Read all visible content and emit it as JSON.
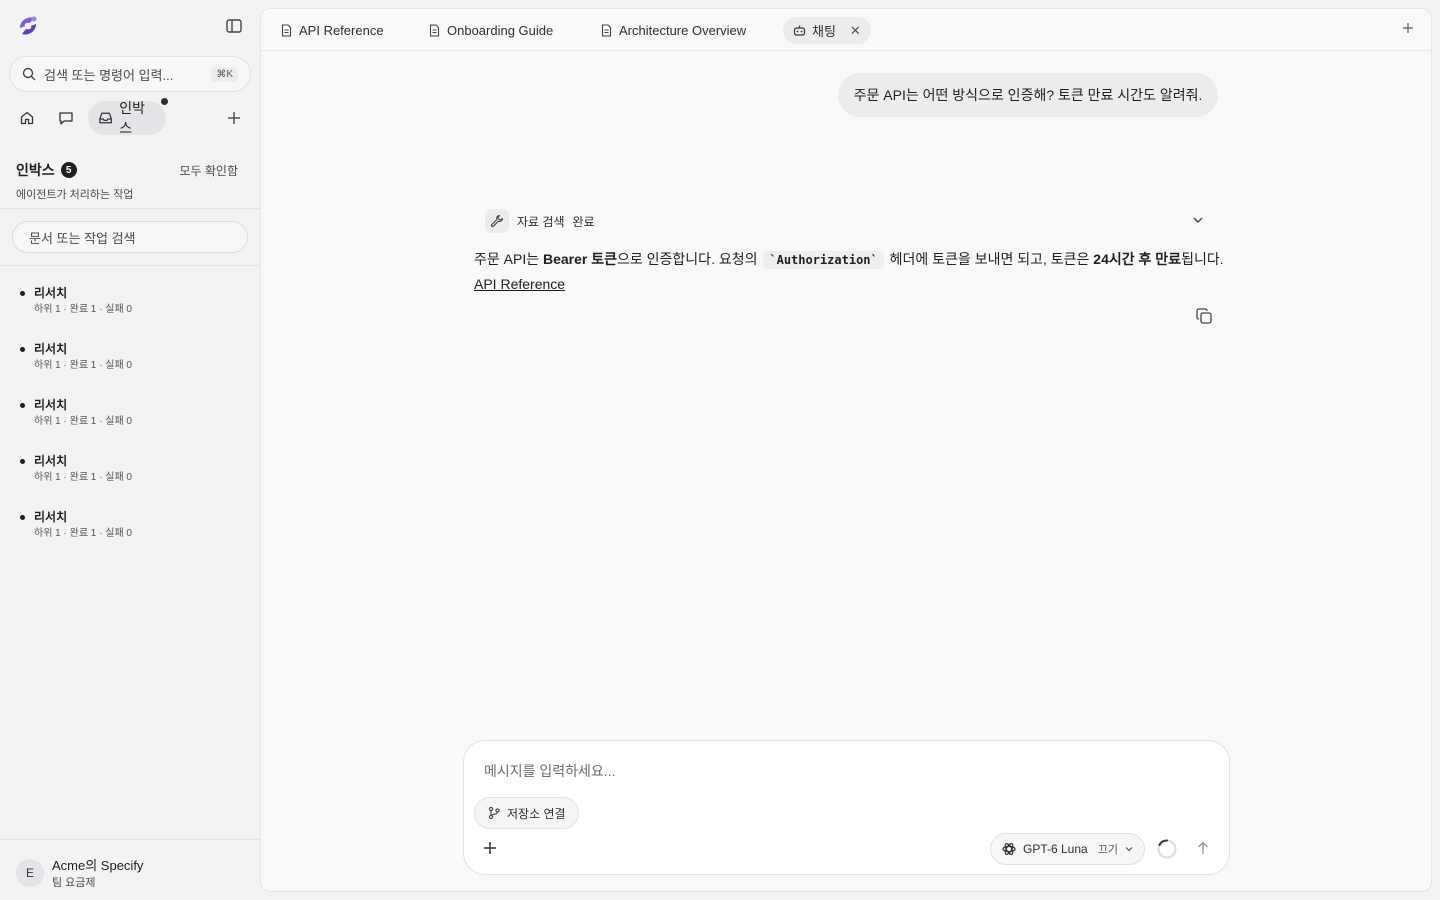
{
  "sidebar": {
    "search_placeholder": "검색 또는 명령어 입력...",
    "search_shortcut": "⌘K",
    "nav_inbox_label": "인박스",
    "inbox": {
      "title": "인박스",
      "count": "5",
      "mark_all": "모두 확인함",
      "subtitle": "에이전트가 처리하는 작업"
    },
    "doc_search_placeholder": "문서 또는 작업 검색",
    "tasks": [
      {
        "title": "리서치",
        "meta": "하위 1 · 완료 1 · 실패 0"
      },
      {
        "title": "리서치",
        "meta": "하위 1 · 완료 1 · 실패 0"
      },
      {
        "title": "리서치",
        "meta": "하위 1 · 완료 1 · 실패 0"
      },
      {
        "title": "리서치",
        "meta": "하위 1 · 완료 1 · 실패 0"
      },
      {
        "title": "리서치",
        "meta": "하위 1 · 완료 1 · 실패 0"
      }
    ],
    "user": {
      "initial": "E",
      "name": "Acme의 Specify",
      "plan": "팀 요금제"
    }
  },
  "tabs": [
    {
      "label": "API Reference"
    },
    {
      "label": "Onboarding Guide"
    },
    {
      "label": "Architecture Overview"
    },
    {
      "label": "채팅"
    }
  ],
  "chat": {
    "user_message": "주문 API는 어떤 방식으로 인증해? 토큰 만료 시간도 알려줘.",
    "tool": {
      "name": "자료 검색",
      "status": "완료"
    },
    "answer": {
      "p1": "주문 API는 ",
      "b1": "Bearer 토큰",
      "p2": "으로 인증합니다. 요청의 ",
      "code": "`Authorization`",
      "p3": " 헤더에 토큰을 보내면 되고, 토큰은 ",
      "b2": "24시간 후 만료",
      "p4": "됩니다.",
      "link": "API Reference"
    }
  },
  "composer": {
    "placeholder": "메시지를 입력하세요...",
    "repo_button": "저장소 연결",
    "model": "GPT-6 Luna",
    "model_toggle": "끄기"
  }
}
